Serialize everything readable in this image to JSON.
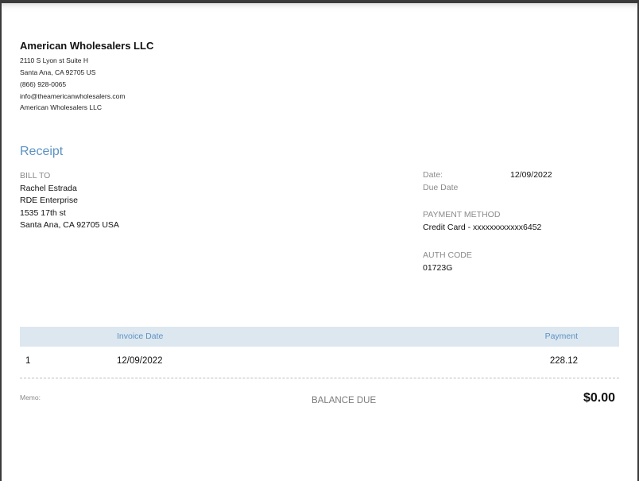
{
  "company": {
    "name": "American Wholesalers LLC",
    "address_line1": "2110 S Lyon st Suite H",
    "address_line2": "Santa Ana, CA  92705 US",
    "phone": "(866) 928-0065",
    "email": "info@theamericanwholesalers.com",
    "name_repeat": "American Wholesalers LLC"
  },
  "document": {
    "title": "Receipt"
  },
  "bill_to": {
    "label": "BILL TO",
    "name": "Rachel Estrada",
    "company": "RDE Enterprise",
    "street": "1535 17th st",
    "city": "Santa Ana, CA  92705 USA"
  },
  "meta": {
    "date_label": "Date:",
    "date_value": "12/09/2022",
    "due_date_label": "Due Date",
    "payment_method_label": "PAYMENT METHOD",
    "payment_method_value": "Credit Card - xxxxxxxxxxxx6452",
    "auth_code_label": "AUTH CODE",
    "auth_code_value": "01723G"
  },
  "table": {
    "headers": {
      "invoice_date": "Invoice Date",
      "payment": "Payment"
    },
    "rows": [
      {
        "num": "1",
        "invoice_date": "12/09/2022",
        "payment": "228.12"
      }
    ]
  },
  "footer": {
    "memo_label": "Memo:",
    "balance_label": "BALANCE DUE",
    "balance_value": "$0.00"
  },
  "colors": {
    "accent": "#5b93c3",
    "table_header_bg": "#dde7f0"
  }
}
